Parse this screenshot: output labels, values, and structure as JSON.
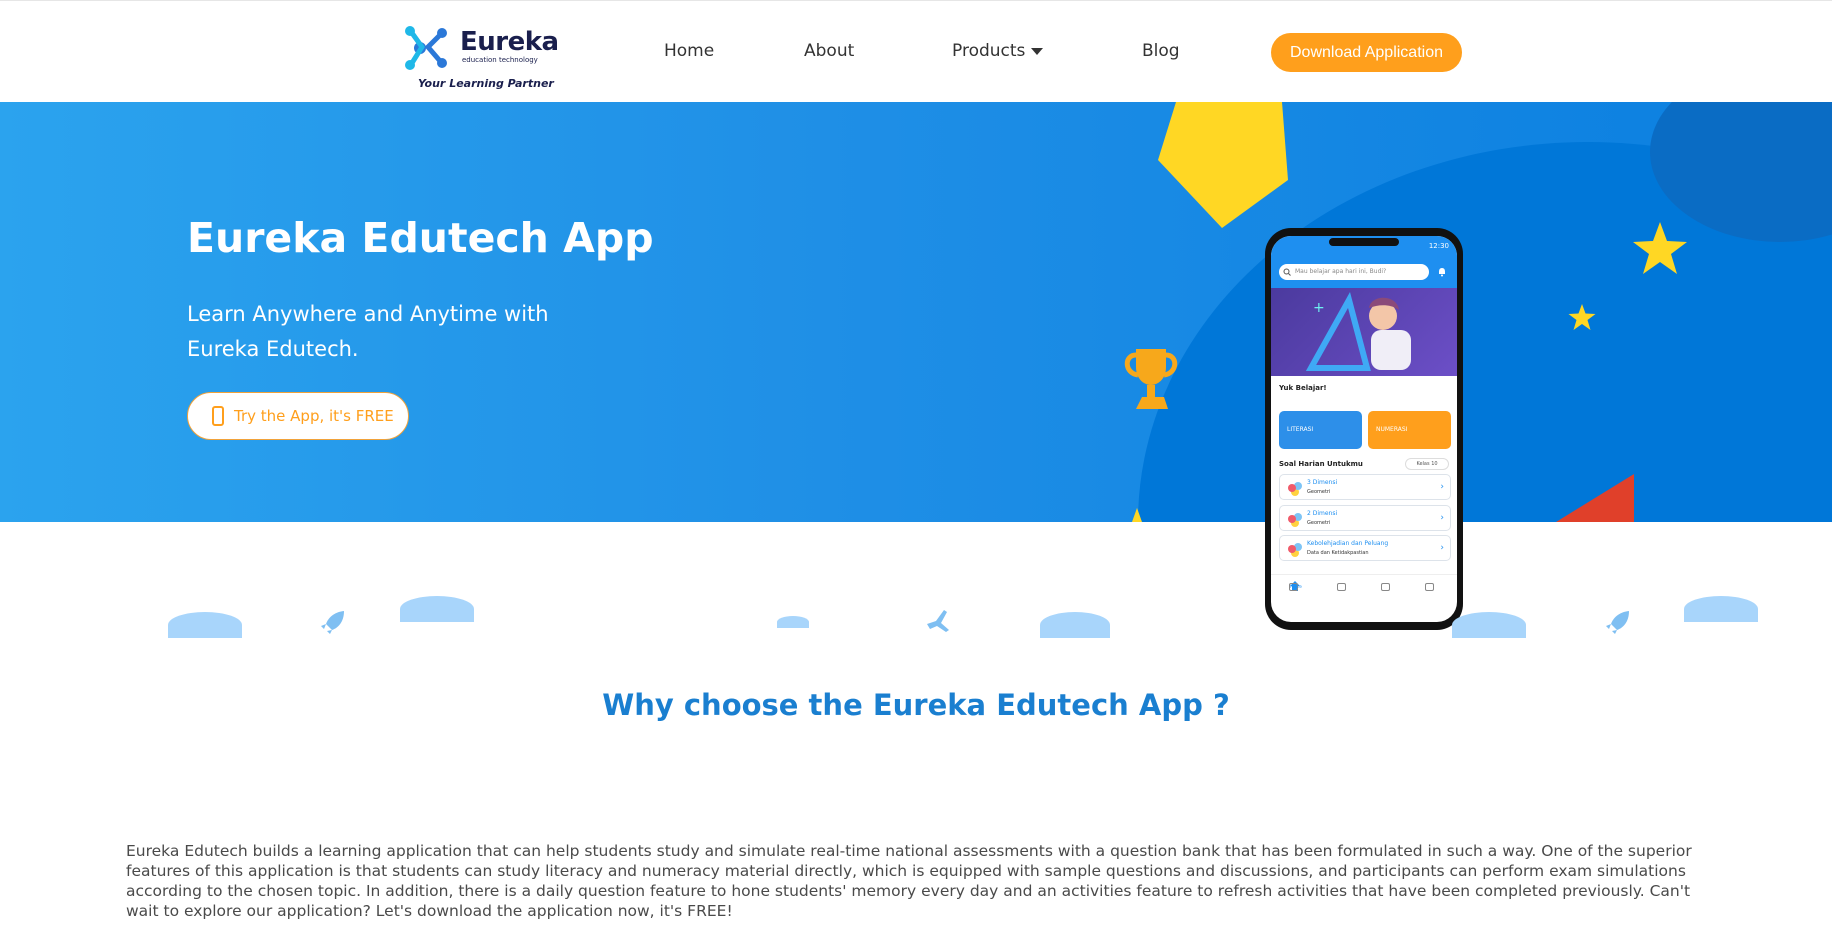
{
  "brand": {
    "name": "Eureka",
    "subtitle": "education technology",
    "tagline": "Your Learning Partner"
  },
  "nav": {
    "home": "Home",
    "about": "About",
    "products": "Products",
    "blog": "Blog",
    "download": "Download Application"
  },
  "hero": {
    "title": "Eureka Edutech App",
    "subtitle": "Learn Anywhere and Anytime with Eureka Edutech.",
    "cta": "Try the App, it's FREE"
  },
  "phone": {
    "time": "12:30",
    "search_placeholder": "Mau belajar apa hari ini, Budi?",
    "section1": "Yuk Belajar!",
    "card_literasi": "LITERASI",
    "card_numerasi": "NUMERASI",
    "section2": "Soal Harian Untukmu",
    "kelas": "Kelas 10",
    "rows": [
      {
        "title": "3 Dimensi",
        "sub": "Geometri"
      },
      {
        "title": "2 Dimensi",
        "sub": "Geometri"
      },
      {
        "title": "Kebolehjadian dan Peluang",
        "sub": "Data dan Ketidakpastian"
      }
    ],
    "nav_home": "Home"
  },
  "why": {
    "title": "Why choose the Eureka Edutech App ?",
    "description": "Eureka Edutech builds a learning application that can help students study and simulate real-time national assessments with a question bank that has been formulated in such a way. One of the superior features of this application is that students can study literacy and numeracy material directly, which is equipped with sample questions and discussions, and participants can perform exam simulations according to the chosen topic. In addition, there is a daily question feature to hone students' memory every day and an activities feature to refresh activities that have been completed previously. Can't wait to explore our application? Let's download the application now, it's FREE!"
  },
  "colors": {
    "primary_blue": "#1f8fe6",
    "accent_orange": "#ff9f1c",
    "heading_blue": "#1a7fd0",
    "yellow": "#ffd724"
  }
}
